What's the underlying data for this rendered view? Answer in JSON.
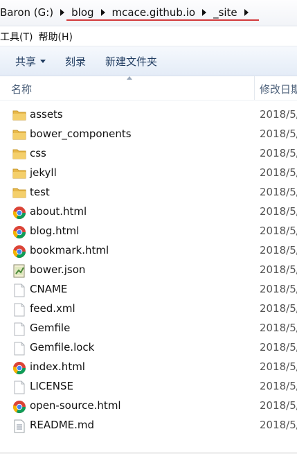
{
  "address": {
    "crumbs": [
      "Baron (G:)",
      "blog",
      "mcace.github.io",
      "_site"
    ]
  },
  "menu": {
    "tools": "工具(T)",
    "help": "帮助(H)"
  },
  "toolbar": {
    "share": "共享",
    "burn": "刻录",
    "new_folder": "新建文件夹"
  },
  "columns": {
    "name": "名称",
    "date": "修改日期"
  },
  "files": [
    {
      "name": "assets",
      "type": "folder",
      "date": "2018/5/"
    },
    {
      "name": "bower_components",
      "type": "folder",
      "date": "2018/5/"
    },
    {
      "name": "css",
      "type": "folder",
      "date": "2018/5/"
    },
    {
      "name": "jekyll",
      "type": "folder",
      "date": "2018/5/"
    },
    {
      "name": "test",
      "type": "folder",
      "date": "2018/5/"
    },
    {
      "name": "about.html",
      "type": "chrome-html",
      "date": "2018/5/"
    },
    {
      "name": "blog.html",
      "type": "chrome-html",
      "date": "2018/5/"
    },
    {
      "name": "bookmark.html",
      "type": "chrome-html",
      "date": "2018/5/"
    },
    {
      "name": "bower.json",
      "type": "json",
      "date": "2018/5/"
    },
    {
      "name": "CNAME",
      "type": "blank",
      "date": "2018/5/"
    },
    {
      "name": "feed.xml",
      "type": "blank",
      "date": "2018/5/"
    },
    {
      "name": "Gemfile",
      "type": "blank",
      "date": "2018/5/"
    },
    {
      "name": "Gemfile.lock",
      "type": "blank",
      "date": "2018/5/"
    },
    {
      "name": "index.html",
      "type": "chrome-html",
      "date": "2018/5/"
    },
    {
      "name": "LICENSE",
      "type": "blank",
      "date": "2018/5/"
    },
    {
      "name": "open-source.html",
      "type": "chrome-html",
      "date": "2018/5/"
    },
    {
      "name": "README.md",
      "type": "text",
      "date": "2018/5/"
    }
  ],
  "colors": {
    "underline": "#d2393b",
    "folder": "#e8b84a",
    "header_text": "#4c607a"
  }
}
